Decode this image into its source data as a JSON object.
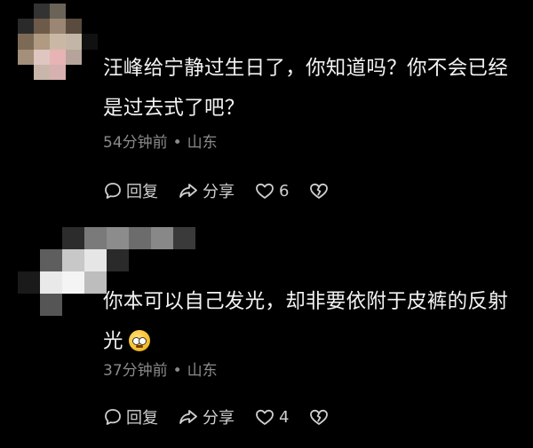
{
  "comments": [
    {
      "text": "汪峰给宁静过生日了，你知道吗？你不会已经是过去式了吧？",
      "time": "54分钟前",
      "location": "山东",
      "reply_label": "回复",
      "share_label": "分享",
      "like_count": "6"
    },
    {
      "text": "你本可以自己发光，却非要依附于皮裤的反射光",
      "time": "37分钟前",
      "location": "山东",
      "reply_label": "回复",
      "share_label": "分享",
      "like_count": "4"
    }
  ],
  "separator": "•",
  "icons": {
    "reply": "reply-bubble-icon",
    "share": "share-arrow-icon",
    "like": "heart-icon",
    "dislike": "broken-heart-icon",
    "emoji": "rolling-eyes-emoji"
  },
  "colors": {
    "background": "#000000",
    "text": "#f3f3f3",
    "meta": "#8a8a8a",
    "action": "#cfcfcf"
  }
}
